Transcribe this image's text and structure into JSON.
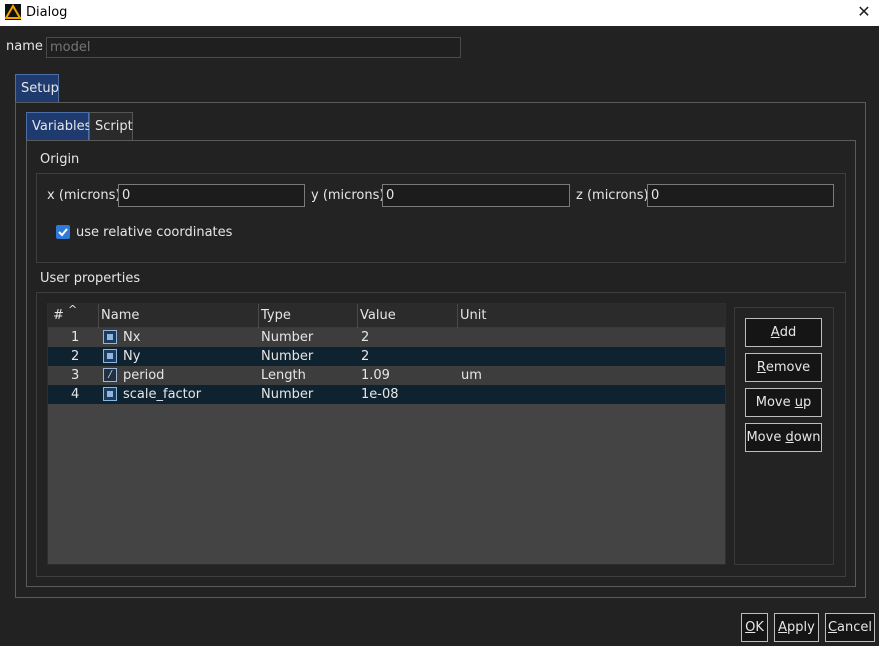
{
  "window": {
    "title": "Dialog",
    "close_glyph": "✕",
    "app_icon": "warning-triangle-icon"
  },
  "name_field": {
    "label": "name",
    "placeholder": "model",
    "value": ""
  },
  "outer_tabs": [
    {
      "label": "Setup",
      "active": true
    }
  ],
  "inner_tabs": [
    {
      "label": "Variables",
      "active": true
    },
    {
      "label": "Script",
      "active": false
    }
  ],
  "origin": {
    "title": "Origin",
    "x": {
      "label": "x (microns)",
      "value": "0"
    },
    "y": {
      "label": "y (microns)",
      "value": "0"
    },
    "z": {
      "label": "z (microns)",
      "value": "0"
    },
    "relative": {
      "label": "use relative coordinates",
      "checked": true
    }
  },
  "user_properties": {
    "title": "User properties",
    "columns": [
      "#",
      "Name",
      "Type",
      "Value",
      "Unit"
    ],
    "sort_indicator": "^",
    "rows": [
      {
        "num": "1",
        "name": "Nx",
        "type": "Number",
        "value": "2",
        "unit": "",
        "icon": "number-variable-icon"
      },
      {
        "num": "2",
        "name": "Ny",
        "type": "Number",
        "value": "2",
        "unit": "",
        "icon": "number-variable-icon"
      },
      {
        "num": "3",
        "name": "period",
        "type": "Length",
        "value": "1.09",
        "unit": "um",
        "icon": "length-variable-icon"
      },
      {
        "num": "4",
        "name": "scale_factor",
        "type": "Number",
        "value": "1e-08",
        "unit": "",
        "icon": "number-variable-icon"
      }
    ],
    "buttons": {
      "add": {
        "key": "A",
        "rest": "dd"
      },
      "remove": {
        "key": "R",
        "rest": "emove"
      },
      "move_up": {
        "pre": "Move ",
        "key": "u",
        "rest": "p"
      },
      "move_down": {
        "pre": "Move ",
        "key": "d",
        "rest": "own"
      }
    }
  },
  "footer": {
    "ok": {
      "key": "O",
      "rest": "K"
    },
    "apply": {
      "key": "A",
      "rest": "pply"
    },
    "cancel": {
      "key": "C",
      "rest": "ancel"
    }
  },
  "colors": {
    "accent": "#1e3a6e",
    "checkbox": "#2f7ad8",
    "row_alt": "#0f2230"
  }
}
